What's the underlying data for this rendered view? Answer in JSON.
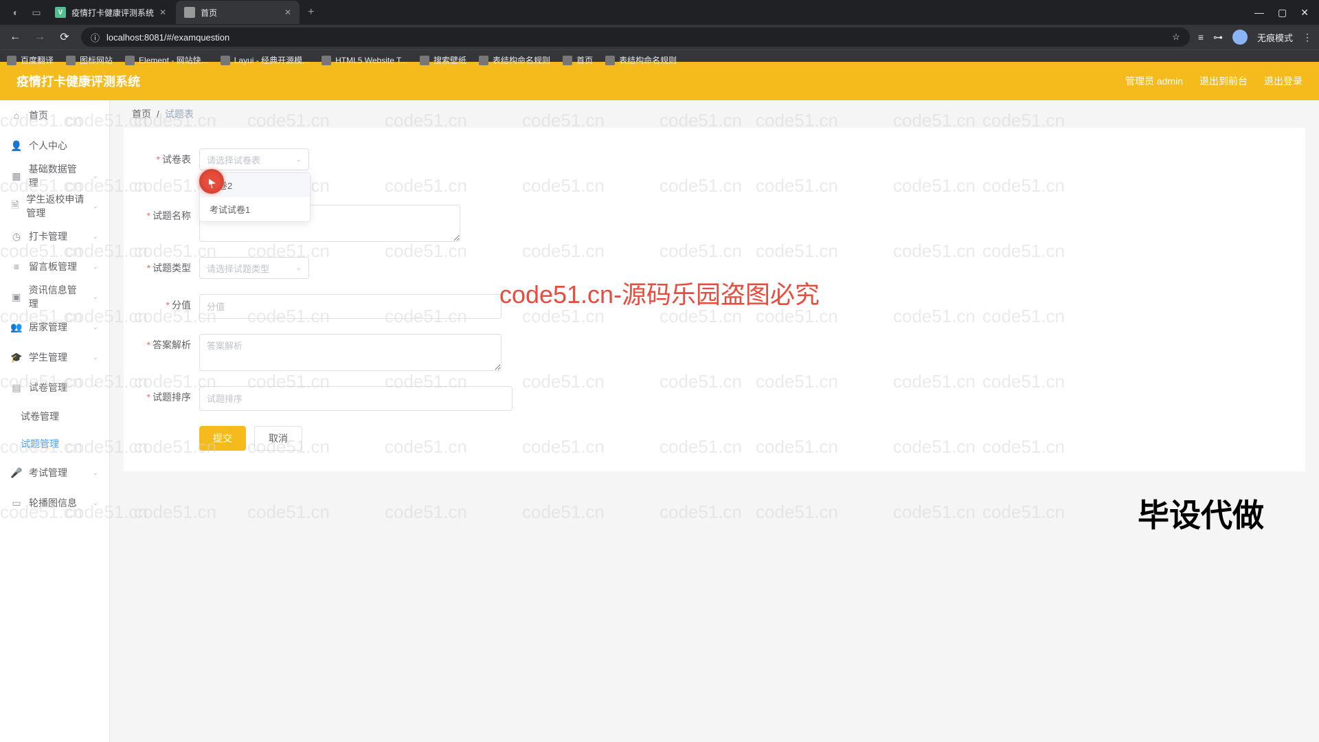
{
  "browser": {
    "tabs": [
      {
        "title": "疫情打卡健康评测系统"
      },
      {
        "title": "首页"
      }
    ],
    "url": "localhost:8081/#/examquestion",
    "profile": "无痕模式",
    "bookmarks": [
      "百度翻译",
      "图标网站",
      "Element - 网站快...",
      "Layui - 经典开源模...",
      "HTML5 Website T...",
      "搜索壁纸",
      "表结构命名规则",
      "首页",
      "表结构命名规则"
    ]
  },
  "header": {
    "title": "疫情打卡健康评测系统",
    "user": "管理员 admin",
    "back": "退出到前台",
    "logout": "退出登录"
  },
  "sidebar": {
    "items": [
      {
        "label": "首页",
        "icon": "home"
      },
      {
        "label": "个人中心",
        "icon": "user"
      },
      {
        "label": "基础数据管理",
        "icon": "grid",
        "expandable": true
      },
      {
        "label": "学生返校申请管理",
        "icon": "doc",
        "expandable": true
      },
      {
        "label": "打卡管理",
        "icon": "clock",
        "expandable": true
      },
      {
        "label": "留言板管理",
        "icon": "list",
        "expandable": true
      },
      {
        "label": "资讯信息管理",
        "icon": "book",
        "expandable": true
      },
      {
        "label": "居家管理",
        "icon": "people",
        "expandable": true
      },
      {
        "label": "学生管理",
        "icon": "grad",
        "expandable": true
      },
      {
        "label": "试卷管理",
        "icon": "paper",
        "expandable": true,
        "expanded": true,
        "children": [
          {
            "label": "试卷管理"
          },
          {
            "label": "试题管理",
            "active": true
          }
        ]
      },
      {
        "label": "考试管理",
        "icon": "mic",
        "expandable": true
      },
      {
        "label": "轮播图信息",
        "icon": "image",
        "expandable": true
      }
    ]
  },
  "breadcrumb": {
    "home": "首页",
    "current": "试题表"
  },
  "form": {
    "paper": {
      "label": "试卷表",
      "placeholder": "请选择试卷表",
      "options": [
        "试卷2",
        "考试试卷1"
      ]
    },
    "name": {
      "label": "试题名称",
      "value": ""
    },
    "type": {
      "label": "试题类型",
      "placeholder": "请选择试题类型"
    },
    "score": {
      "label": "分值",
      "placeholder": "分值"
    },
    "analysis": {
      "label": "答案解析",
      "placeholder": "答案解析"
    },
    "order": {
      "label": "试题排序",
      "placeholder": "试题排序"
    },
    "submit": "提交",
    "cancel": "取消"
  },
  "watermark": {
    "grid_text": "code51.cn",
    "center": "code51.cn-源码乐园盗图必究",
    "bottom": "毕设代做"
  }
}
